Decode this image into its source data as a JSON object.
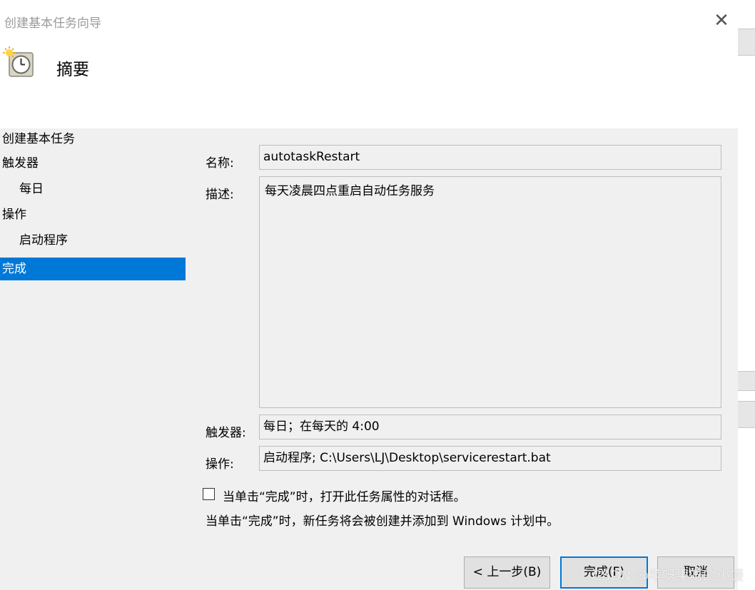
{
  "window": {
    "title": "创建基本任务向导",
    "close_symbol": "✕"
  },
  "header": {
    "icon": "task-clock-icon",
    "title": "摘要"
  },
  "nav": {
    "items": [
      {
        "label": "创建基本任务",
        "level": "top",
        "selected": false
      },
      {
        "label": "触发器",
        "level": "top",
        "selected": false
      },
      {
        "label": "每日",
        "level": "sub",
        "selected": false
      },
      {
        "label": "操作",
        "level": "top",
        "selected": false
      },
      {
        "label": "启动程序",
        "level": "sub",
        "selected": false
      },
      {
        "label": "完成",
        "level": "top",
        "selected": true
      }
    ]
  },
  "summary": {
    "name_label": "名称:",
    "name_value": "autotaskRestart",
    "description_label": "描述:",
    "description_value": "每天凌晨四点重启自动任务服务",
    "trigger_label": "触发器:",
    "trigger_value": "每日；在每天的 4:00",
    "action_label": "操作:",
    "action_value": "启动程序; C:\\Users\\LJ\\Desktop\\servicerestart.bat"
  },
  "options": {
    "open_properties_label": "当单击“完成”时，打开此任务属性的对话框。",
    "open_properties_checked": false,
    "info_text": "当单击“完成”时，新任务将会被创建并添加到 Windows 计划中。"
  },
  "buttons": {
    "back": "< 上一步(B)",
    "finish": "完成(F)",
    "cancel": "取消"
  },
  "watermark": "CSDN @苹呀果呀的小馒",
  "colors": {
    "selection": "#0078d7",
    "dialog_bg": "#f0f0f0"
  }
}
